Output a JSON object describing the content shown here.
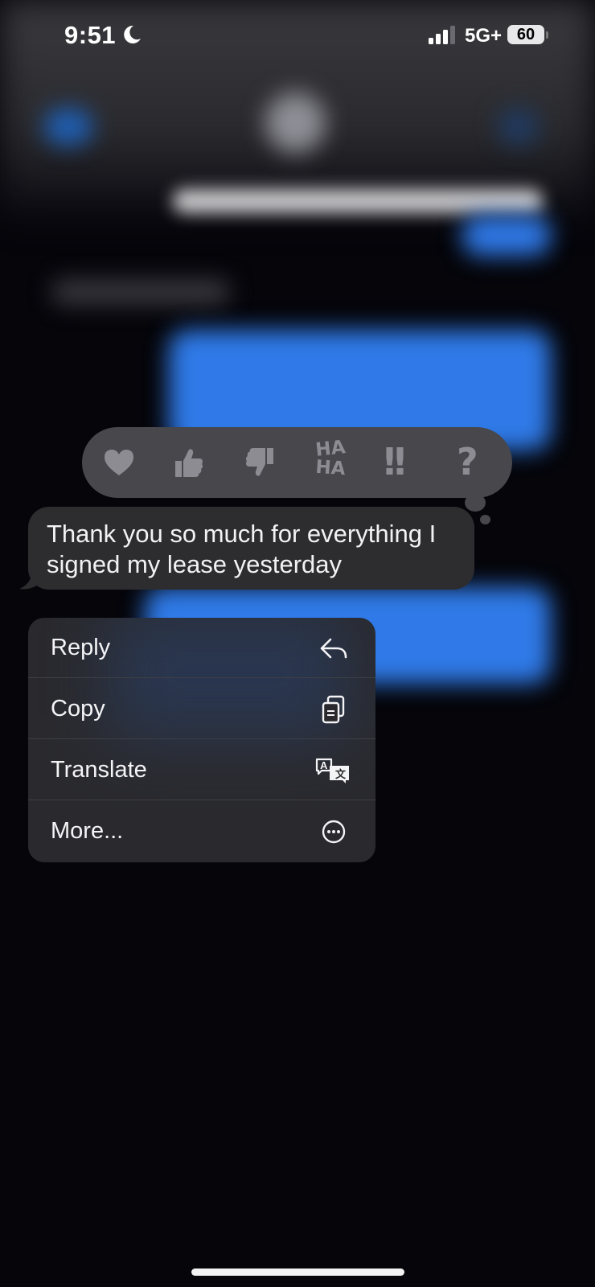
{
  "status_bar": {
    "time": "9:51",
    "network": "5G+",
    "battery": "60",
    "icons": [
      "moon-icon",
      "signal-icon",
      "battery-icon"
    ]
  },
  "tapbacks": [
    {
      "name": "heart-icon"
    },
    {
      "name": "thumbs-up-icon"
    },
    {
      "name": "thumbs-down-icon"
    },
    {
      "name": "haha-icon",
      "line1": "HA",
      "line2": "HA"
    },
    {
      "name": "exclamation-icon",
      "label": "!!"
    },
    {
      "name": "question-icon",
      "label": "?"
    }
  ],
  "message": {
    "text": "Thank you so much for everything I signed my lease yesterday"
  },
  "menu": {
    "reply": "Reply",
    "copy": "Copy",
    "translate": "Translate",
    "more": "More..."
  },
  "colors": {
    "background": "#05050a",
    "bubble": "#2d2d30",
    "tapback_bar": "#47474c",
    "menu": "#2a2a2e",
    "tapback_icon": "#8c8c92",
    "blue_bubble": "#2f7ae8"
  }
}
